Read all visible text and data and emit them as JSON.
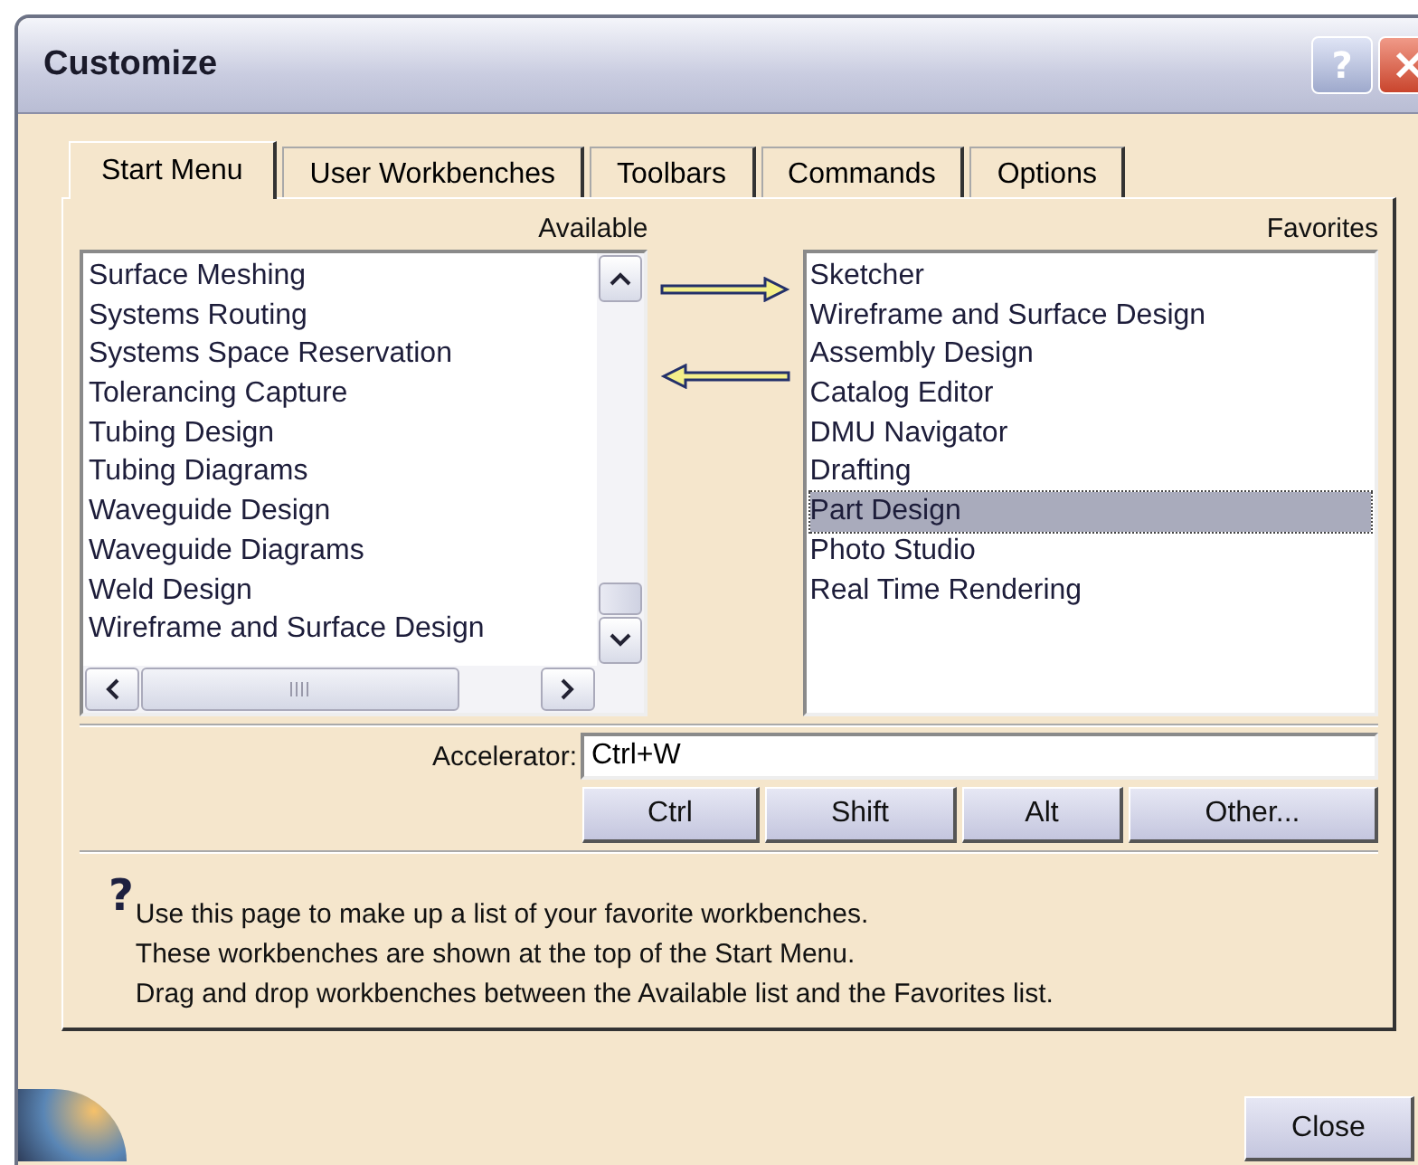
{
  "window": {
    "title": "Customize",
    "help_button": "?"
  },
  "tabs": [
    {
      "label": "Start Menu",
      "selected": true
    },
    {
      "label": "User Workbenches",
      "selected": false
    },
    {
      "label": "Toolbars",
      "selected": false
    },
    {
      "label": "Commands",
      "selected": false
    },
    {
      "label": "Options",
      "selected": false
    }
  ],
  "available": {
    "label": "Available",
    "items": [
      {
        "label": "Surface Meshing",
        "selected": false
      },
      {
        "label": "Systems Routing",
        "selected": false
      },
      {
        "label": "Systems Space Reservation",
        "selected": false
      },
      {
        "label": "Tolerancing Capture",
        "selected": false
      },
      {
        "label": "Tubing Design",
        "selected": false
      },
      {
        "label": "Tubing Diagrams",
        "selected": false
      },
      {
        "label": "Waveguide Design",
        "selected": false
      },
      {
        "label": "Waveguide Diagrams",
        "selected": false
      },
      {
        "label": "Weld Design",
        "selected": false
      },
      {
        "label": "Wireframe and Surface Design",
        "selected": false
      }
    ]
  },
  "favorites": {
    "label": "Favorites",
    "items": [
      {
        "label": "Sketcher",
        "selected": false
      },
      {
        "label": "Wireframe and Surface Design",
        "selected": false
      },
      {
        "label": "Assembly Design",
        "selected": false
      },
      {
        "label": "Catalog Editor",
        "selected": false
      },
      {
        "label": "DMU Navigator",
        "selected": false
      },
      {
        "label": "Drafting",
        "selected": false
      },
      {
        "label": "Part Design",
        "selected": true
      },
      {
        "label": "Photo Studio",
        "selected": false
      },
      {
        "label": "Real Time Rendering",
        "selected": false
      }
    ]
  },
  "accelerator": {
    "label": "Accelerator:",
    "value": "Ctrl+W"
  },
  "modifier_buttons": [
    "Ctrl",
    "Shift",
    "Alt",
    "Other..."
  ],
  "help": {
    "icon": "?",
    "lines": [
      "Use this page to make up a list of your favorite workbenches.",
      "These workbenches are shown at the top of the Start Menu.",
      "Drag and drop workbenches between the Available list and the Favorites list."
    ]
  },
  "close_button": "Close"
}
